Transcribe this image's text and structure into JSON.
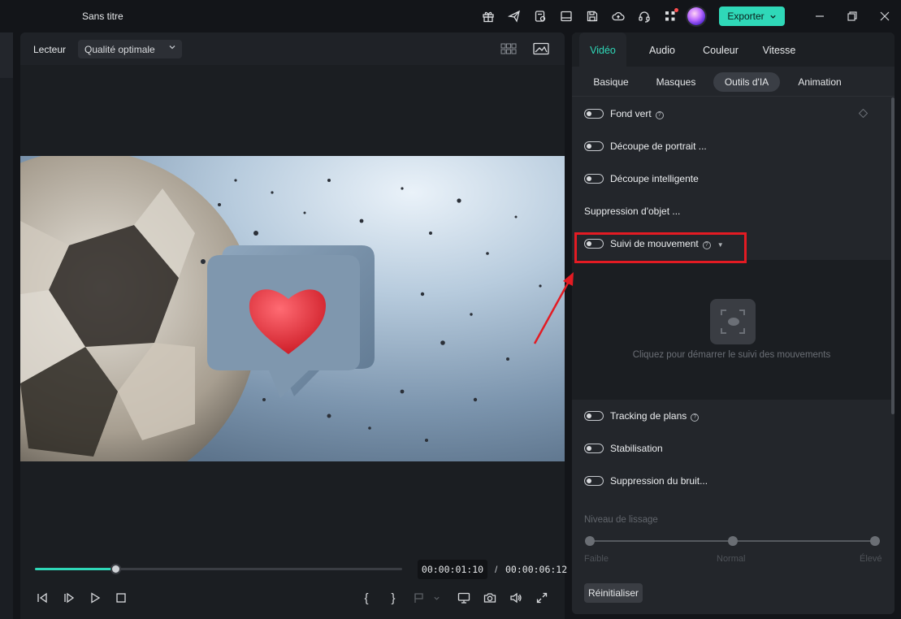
{
  "window": {
    "title": "Sans titre"
  },
  "titlebar": {
    "icons": [
      "gift-icon",
      "send-icon",
      "clipboard-gear-icon",
      "layout-icon",
      "save-icon",
      "cloud-upload-icon",
      "headset-icon",
      "apps-grid-icon"
    ],
    "export_label": "Exporter",
    "accent": "#2fd8b8"
  },
  "player": {
    "label": "Lecteur",
    "quality": "Qualité optimale",
    "time_current": "00:00:01:10",
    "time_separator": "/",
    "time_total": "00:00:06:12",
    "progress": 0.22,
    "marker_open": "{",
    "marker_close": "}"
  },
  "panel": {
    "tabs": [
      {
        "label": "Vidéo",
        "active": true
      },
      {
        "label": "Audio",
        "active": false
      },
      {
        "label": "Couleur",
        "active": false
      },
      {
        "label": "Vitesse",
        "active": false
      }
    ],
    "subtabs": [
      {
        "label": "Basique",
        "active": false
      },
      {
        "label": "Masques",
        "active": false
      },
      {
        "label": "Outils d'IA",
        "active": true
      },
      {
        "label": "Animation",
        "active": false
      }
    ],
    "rows": {
      "green_screen": "Fond vert",
      "portrait_cutout": "Découpe de portrait ...",
      "smart_cutout": "Découpe intelligente",
      "object_removal": "Suppression d'objet ...",
      "motion_tracking": "Suivi de mouvement",
      "plane_tracking": "Tracking de plans",
      "stabilization": "Stabilisation",
      "denoise": "Suppression du bruit..."
    },
    "motion_hint": "Cliquez pour démarrer le suivi des mouvements",
    "smoothing": {
      "label": "Niveau de lissage",
      "levels": [
        "Faible",
        "Normal",
        "Élevé"
      ]
    },
    "reset_label": "Réinitialiser"
  },
  "annotation_color": "#e31b23"
}
